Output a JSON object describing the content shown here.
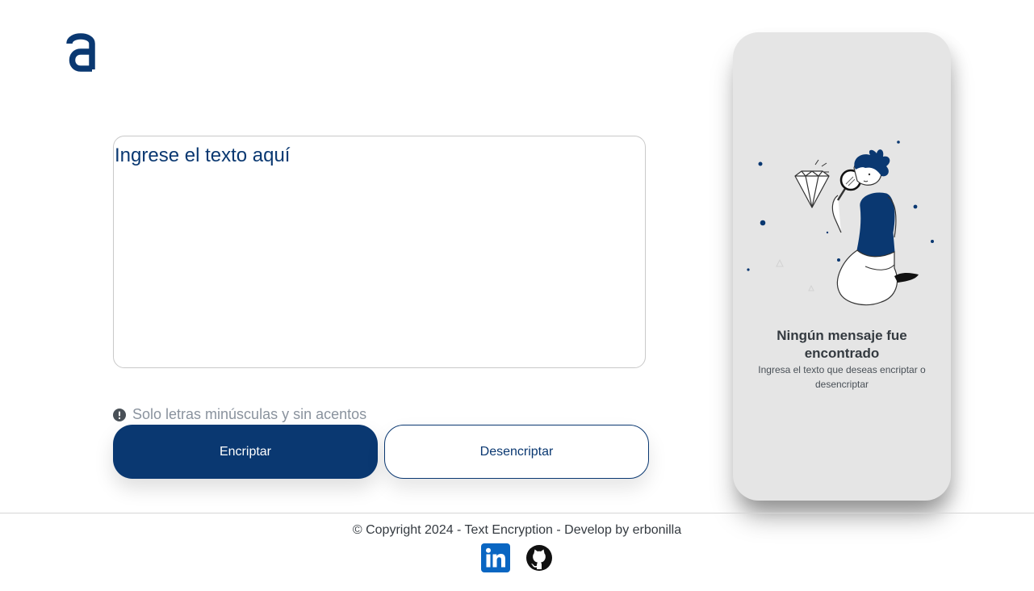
{
  "header": {
    "logo_icon": "alura-a-logo"
  },
  "main": {
    "input": {
      "placeholder": "Ingrese el texto aquí",
      "value": ""
    },
    "hint": {
      "icon": "exclamation-circle-icon",
      "text": "Solo letras minúsculas y sin acentos"
    },
    "buttons": {
      "encrypt_label": "Encriptar",
      "decrypt_label": "Desencriptar"
    }
  },
  "result_panel": {
    "illustration": "person-magnifier-diamond",
    "title": "Ningún mensaje fue encontrado",
    "subtitle": "Ingresa el texto que deseas encriptar o desencriptar"
  },
  "footer": {
    "copyright": "© Copyright 2024 - Text Encryption - Develop by erbonilla",
    "social": [
      {
        "name": "LinkedIn",
        "icon": "linkedin-icon"
      },
      {
        "name": "GitHub",
        "icon": "github-icon"
      }
    ]
  },
  "colors": {
    "primary": "#0a3871",
    "panel_bg": "#e5e5e5",
    "hint": "#8a939e",
    "linkedin": "#0a66c2"
  }
}
